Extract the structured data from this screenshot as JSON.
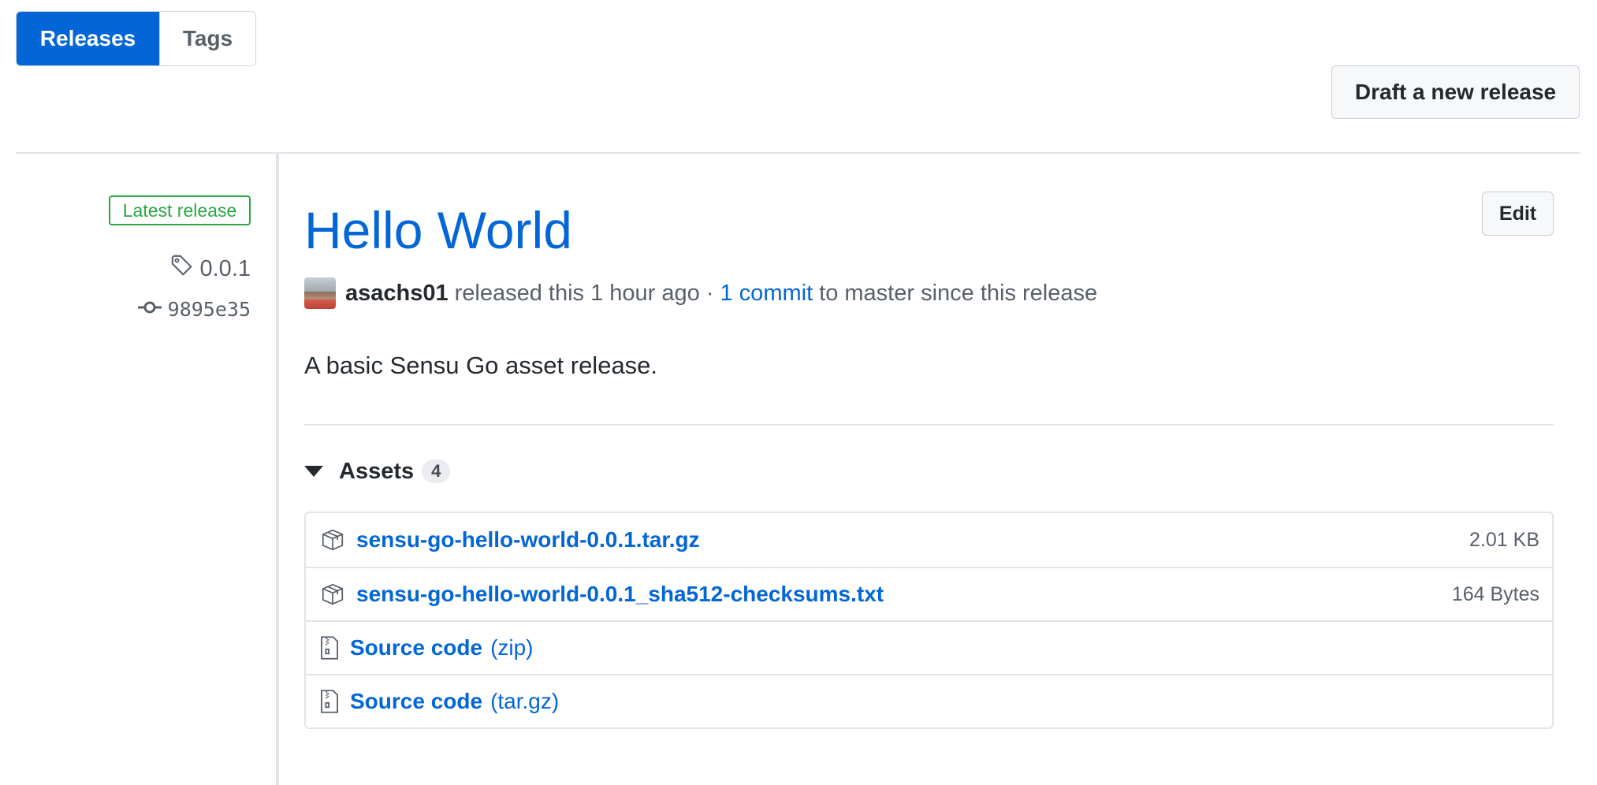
{
  "tabs": [
    {
      "label": "Releases",
      "active": true
    },
    {
      "label": "Tags",
      "active": false
    }
  ],
  "toolbar": {
    "draft_label": "Draft a new release"
  },
  "release": {
    "badge": "Latest release",
    "tag": "0.0.1",
    "commit": "9895e35",
    "title": "Hello World",
    "edit_label": "Edit",
    "author": "asachs01",
    "released_text": "released this 1 hour ago ·",
    "commits_link": "1 commit",
    "since_text": "to master since this release",
    "description": "A basic Sensu Go asset release."
  },
  "assets": {
    "label": "Assets",
    "count": "4",
    "items": [
      {
        "name": "sensu-go-hello-world-0.0.1.tar.gz",
        "sub": "",
        "size": "2.01 KB",
        "icon": "package-icon"
      },
      {
        "name": "sensu-go-hello-world-0.0.1_sha512-checksums.txt",
        "sub": "",
        "size": "164 Bytes",
        "icon": "package-icon"
      },
      {
        "name": "Source code",
        "sub": "(zip)",
        "size": "",
        "icon": "file-zip-icon"
      },
      {
        "name": "Source code",
        "sub": "(tar.gz)",
        "size": "",
        "icon": "file-zip-icon"
      }
    ]
  },
  "colors": {
    "accent": "#0366d6",
    "success": "#28a745",
    "muted": "#586069"
  }
}
